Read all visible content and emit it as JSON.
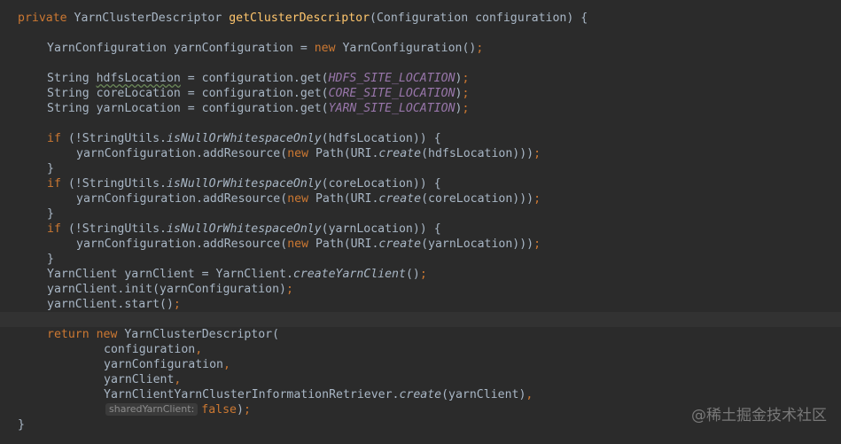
{
  "code": {
    "l1": {
      "kw_private": "private",
      "type": "YarnClusterDescriptor",
      "method": "getClusterDescriptor",
      "params": "(Configuration configuration) {"
    },
    "l2": {
      "decl": "YarnConfiguration yarnConfiguration = ",
      "kw_new": "new",
      "rest": " YarnConfiguration()",
      "semi": ";"
    },
    "l3": {
      "type": "String ",
      "var": "hdfsLocation",
      "mid": " = configuration.get(",
      "const": "HDFS_SITE_LOCATION",
      "close": ")",
      "semi": ";"
    },
    "l4": {
      "prefix": "String coreLocation = configuration.get(",
      "const": "CORE_SITE_LOCATION",
      "close": ")",
      "semi": ";"
    },
    "l5": {
      "prefix": "String yarnLocation = configuration.get(",
      "const": "YARN_SITE_LOCATION",
      "close": ")",
      "semi": ";"
    },
    "l6": {
      "kw_if": "if",
      "a": " (!StringUtils.",
      "static": "isNullOrWhitespaceOnly",
      "b": "(hdfsLocation)) {"
    },
    "l7": {
      "a": "yarnConfiguration.addResource(",
      "kw_new": "new",
      "b": " Path(URI.",
      "static": "create",
      "c": "(hdfsLocation)))",
      "semi": ";"
    },
    "l8": {
      "brace": "}"
    },
    "l9": {
      "kw_if": "if",
      "a": " (!StringUtils.",
      "static": "isNullOrWhitespaceOnly",
      "b": "(coreLocation)) {"
    },
    "l10": {
      "a": "yarnConfiguration.addResource(",
      "kw_new": "new",
      "b": " Path(URI.",
      "static": "create",
      "c": "(coreLocation)))",
      "semi": ";"
    },
    "l11": {
      "brace": "}"
    },
    "l12": {
      "kw_if": "if",
      "a": " (!StringUtils.",
      "static": "isNullOrWhitespaceOnly",
      "b": "(yarnLocation)) {"
    },
    "l13": {
      "a": "yarnConfiguration.addResource(",
      "kw_new": "new",
      "b": " Path(URI.",
      "static": "create",
      "c": "(yarnLocation)))",
      "semi": ";"
    },
    "l14": {
      "brace": "}"
    },
    "l15": {
      "a": "YarnClient yarnClient = YarnClient.",
      "static": "createYarnClient",
      "b": "()",
      "semi": ";"
    },
    "l16": {
      "a": "yarnClient.init(yarnConfiguration)",
      "semi": ";"
    },
    "l17": {
      "a": "yarnClient.start()",
      "semi": ";"
    },
    "l18": {
      "kw_return": "return",
      "kw_new": "new",
      "rest": " YarnClusterDescriptor("
    },
    "l19": {
      "a": "configuration",
      "comma": ","
    },
    "l20": {
      "a": "yarnConfiguration",
      "comma": ","
    },
    "l21": {
      "a": "yarnClient",
      "comma": ","
    },
    "l22": {
      "a": "YarnClientYarnClusterInformationRetriever.",
      "static": "create",
      "b": "(yarnClient)",
      "comma": ","
    },
    "l23": {
      "hint": "sharedYarnClient:",
      "kw_false": "false",
      "close": ")",
      "semi": ";"
    },
    "l24": {
      "brace": "}"
    }
  },
  "watermark": "@稀土掘金技术社区",
  "colors": {
    "background": "#2b2b2b",
    "text": "#a9b7c6",
    "keyword": "#cc7832",
    "method": "#ffc66d",
    "constant": "#9876aa"
  }
}
